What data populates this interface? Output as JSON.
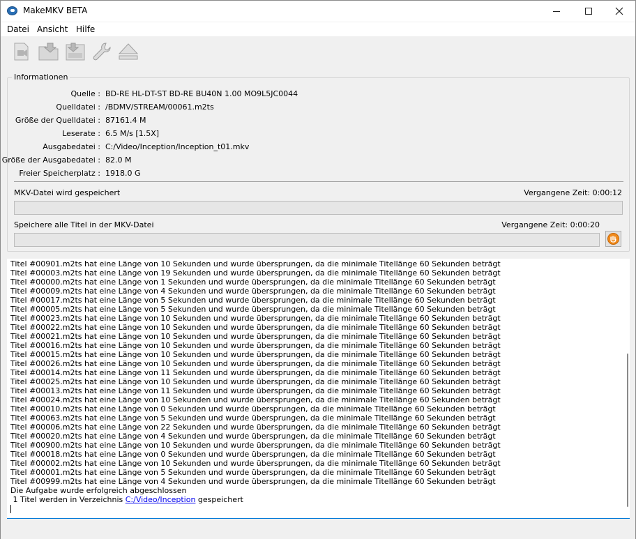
{
  "window": {
    "title": "MakeMKV BETA"
  },
  "menu": {
    "items": [
      "Datei",
      "Ansicht",
      "Hilfe"
    ]
  },
  "toolbar": {
    "icons": [
      "open-files-icon",
      "open-disc-icon",
      "backup-icon",
      "settings-wrench-icon",
      "eject-icon"
    ]
  },
  "info": {
    "group_title": "Informationen",
    "rows": [
      {
        "label": "Quelle :",
        "value": "BD-RE HL-DT-ST BD-RE BU40N 1.00 MO9L5JC0044"
      },
      {
        "label": "Quelldatei :",
        "value": "/BDMV/STREAM/00061.m2ts"
      },
      {
        "label": "Größe der Quelldatei :",
        "value": "87161.4 M"
      },
      {
        "label": "Leserate :",
        "value": "6.5 M/s [1.5X]"
      },
      {
        "label": "Ausgabedatei :",
        "value": "C:/Video/Inception/Inception_t01.mkv"
      },
      {
        "label": "Größe der Ausgabedatei :",
        "value": "82.0 M"
      },
      {
        "label": "Freier Speicherplatz :",
        "value": "1918.0 G"
      }
    ]
  },
  "progress_current": {
    "label": "MKV-Datei wird gespeichert",
    "elapsed": "Vergangene Zeit: 0:00:12",
    "fraction": 0
  },
  "progress_total": {
    "label": "Speichere alle Titel in der MKV-Datei",
    "elapsed": "Vergangene Zeit: 0:00:20",
    "fraction": 0
  },
  "log": {
    "lines": [
      "Titel #00901.m2ts hat eine Länge von 10 Sekunden und wurde übersprungen, da die minimale Titellänge 60 Sekunden beträgt",
      "Titel #00003.m2ts hat eine Länge von 19 Sekunden und wurde übersprungen, da die minimale Titellänge 60 Sekunden beträgt",
      "Titel #00000.m2ts hat eine Länge von 1 Sekunden und wurde übersprungen, da die minimale Titellänge 60 Sekunden beträgt",
      "Titel #00009.m2ts hat eine Länge von 4 Sekunden und wurde übersprungen, da die minimale Titellänge 60 Sekunden beträgt",
      "Titel #00017.m2ts hat eine Länge von 5 Sekunden und wurde übersprungen, da die minimale Titellänge 60 Sekunden beträgt",
      "Titel #00005.m2ts hat eine Länge von 5 Sekunden und wurde übersprungen, da die minimale Titellänge 60 Sekunden beträgt",
      "Titel #00023.m2ts hat eine Länge von 10 Sekunden und wurde übersprungen, da die minimale Titellänge 60 Sekunden beträgt",
      "Titel #00022.m2ts hat eine Länge von 10 Sekunden und wurde übersprungen, da die minimale Titellänge 60 Sekunden beträgt",
      "Titel #00021.m2ts hat eine Länge von 10 Sekunden und wurde übersprungen, da die minimale Titellänge 60 Sekunden beträgt",
      "Titel #00016.m2ts hat eine Länge von 10 Sekunden und wurde übersprungen, da die minimale Titellänge 60 Sekunden beträgt",
      "Titel #00015.m2ts hat eine Länge von 10 Sekunden und wurde übersprungen, da die minimale Titellänge 60 Sekunden beträgt",
      "Titel #00026.m2ts hat eine Länge von 10 Sekunden und wurde übersprungen, da die minimale Titellänge 60 Sekunden beträgt",
      "Titel #00014.m2ts hat eine Länge von 11 Sekunden und wurde übersprungen, da die minimale Titellänge 60 Sekunden beträgt",
      "Titel #00025.m2ts hat eine Länge von 10 Sekunden und wurde übersprungen, da die minimale Titellänge 60 Sekunden beträgt",
      "Titel #00013.m2ts hat eine Länge von 11 Sekunden und wurde übersprungen, da die minimale Titellänge 60 Sekunden beträgt",
      "Titel #00024.m2ts hat eine Länge von 10 Sekunden und wurde übersprungen, da die minimale Titellänge 60 Sekunden beträgt",
      "Titel #00010.m2ts hat eine Länge von 0 Sekunden und wurde übersprungen, da die minimale Titellänge 60 Sekunden beträgt",
      "Titel #00063.m2ts hat eine Länge von 5 Sekunden und wurde übersprungen, da die minimale Titellänge 60 Sekunden beträgt",
      "Titel #00006.m2ts hat eine Länge von 22 Sekunden und wurde übersprungen, da die minimale Titellänge 60 Sekunden beträgt",
      "Titel #00020.m2ts hat eine Länge von 4 Sekunden und wurde übersprungen, da die minimale Titellänge 60 Sekunden beträgt",
      "Titel #00900.m2ts hat eine Länge von 10 Sekunden und wurde übersprungen, da die minimale Titellänge 60 Sekunden beträgt",
      "Titel #00018.m2ts hat eine Länge von 0 Sekunden und wurde übersprungen, da die minimale Titellänge 60 Sekunden beträgt",
      "Titel #00002.m2ts hat eine Länge von 10 Sekunden und wurde übersprungen, da die minimale Titellänge 60 Sekunden beträgt",
      "Titel #00001.m2ts hat eine Länge von 5 Sekunden und wurde übersprungen, da die minimale Titellänge 60 Sekunden beträgt",
      "Titel #00999.m2ts hat eine Länge von 4 Sekunden und wurde übersprungen, da die minimale Titellänge 60 Sekunden beträgt",
      "Die Aufgabe wurde erfolgreich abgeschlossen"
    ],
    "final_prefix": " 1 Titel werden in Verzeichnis ",
    "final_link": "C:/Video/Inception",
    "final_suffix": " gespeichert"
  }
}
